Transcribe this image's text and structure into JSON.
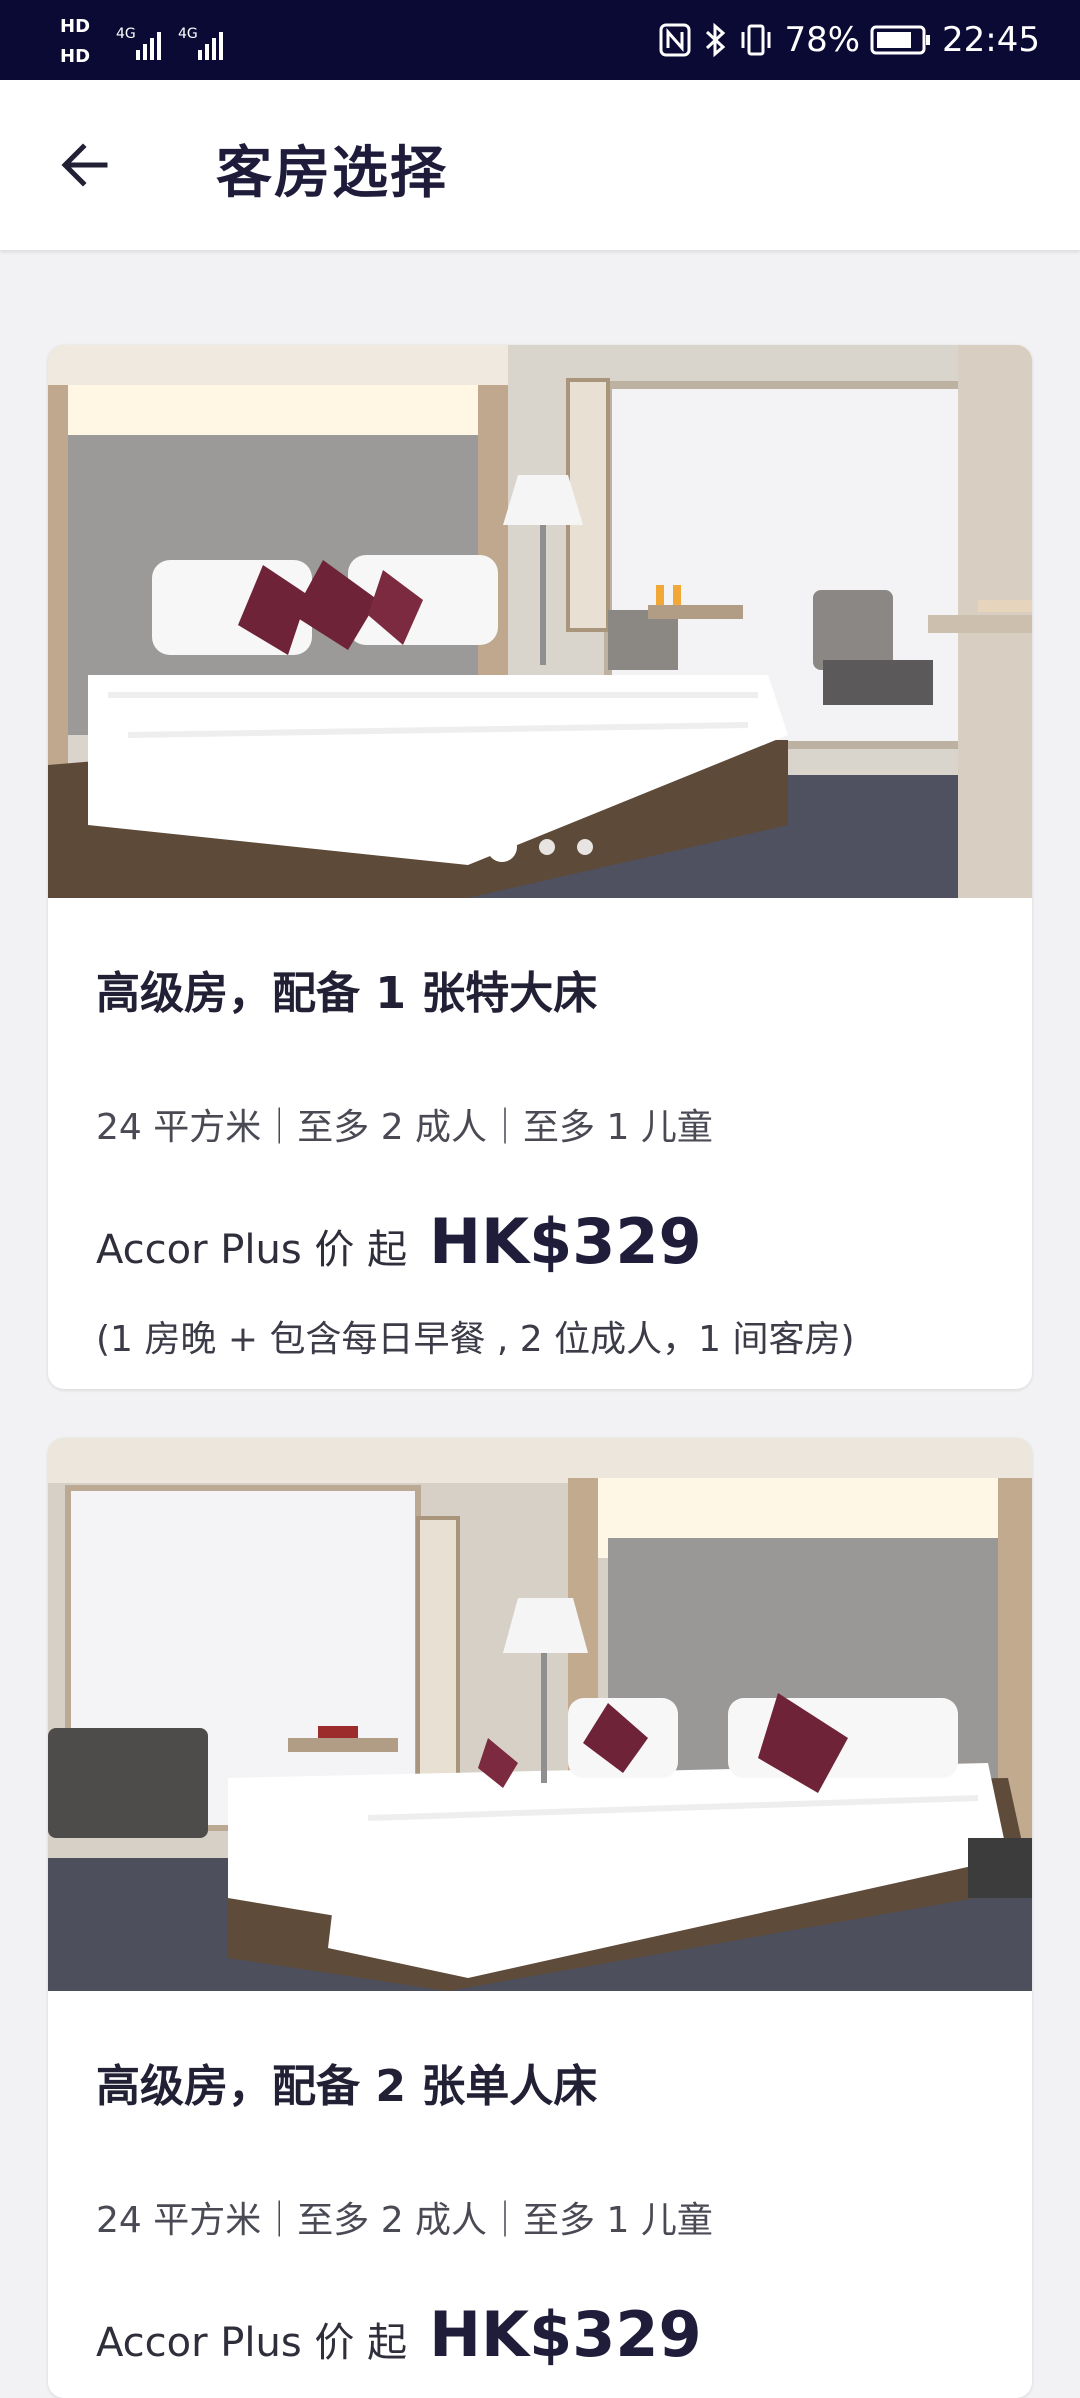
{
  "status_bar": {
    "hd1": "HD",
    "hd2": "HD",
    "net1": "4G",
    "net2": "4G",
    "battery": "78%",
    "time": "22:45"
  },
  "header": {
    "title": "客房选择"
  },
  "rooms": [
    {
      "name": "高级房，配备 1 张特大床",
      "specs": "24 平方米｜至多 2 成人｜至多 1 儿童",
      "price_label": "Accor Plus 价 起",
      "price": "HK$329",
      "note": "(1 房晚 + 包含每日早餐 , 2 位成人，1 间客房)"
    },
    {
      "name": "高级房，配备 2 张单人床",
      "specs": "24 平方米｜至多 2 成人｜至多 1 儿童",
      "price_label": "Accor Plus 价 起",
      "price": "HK$329"
    }
  ],
  "colors": {
    "status_bar_bg": "#0b0a35",
    "title_text": "#1e1c3a",
    "page_bg": "#f2f2f4"
  }
}
